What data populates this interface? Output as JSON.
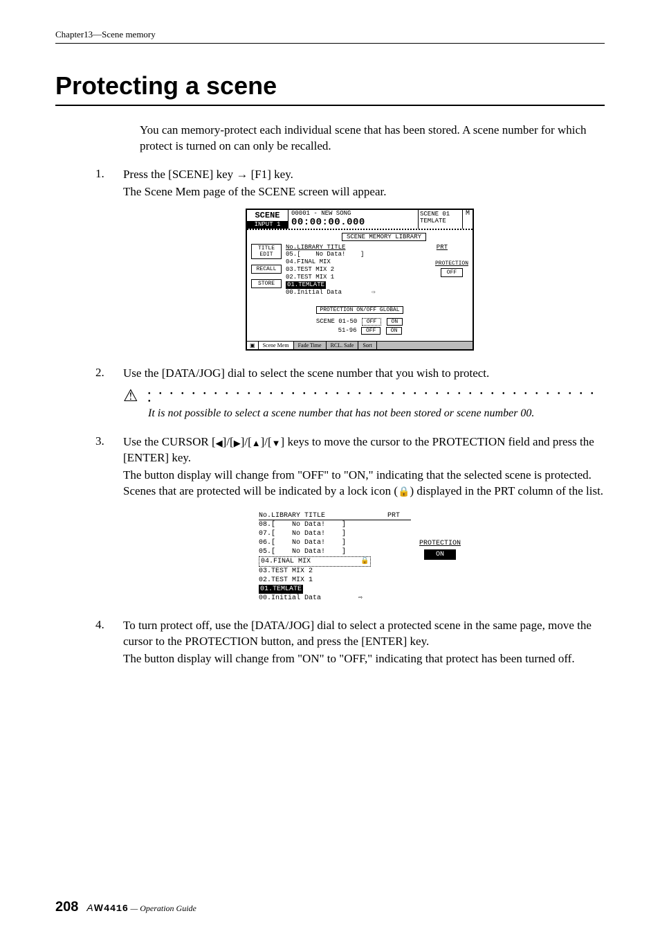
{
  "chapter": "Chapter13—Scene memory",
  "title": "Protecting a scene",
  "intro": "You can memory-protect each individual scene that has been stored. A scene number for which protect is turned on can only be recalled.",
  "step1": {
    "num": "1.",
    "head_a": "Press the [SCENE] key ",
    "head_b": " [F1] key.",
    "body": "The Scene Mem page of the SCENE screen will appear."
  },
  "scr1": {
    "scene": "SCENE",
    "input": "INPUT 1",
    "songid": "00001 - NEW SONG",
    "time": "00:00:00.000",
    "scene_no": "SCENE 01",
    "scene_name": "TEMLATE",
    "m_icon": "M",
    "lib_label": "SCENE MEMORY LIBRARY",
    "hdr_no": "No.LIBRARY TITLE",
    "hdr_prt": "PRT",
    "items": {
      "r0": "05.[    No Data!    ]",
      "r1": "04.FINAL MIX",
      "r2": "03.TEST MIX 2",
      "r3": "02.TEST MIX 1",
      "r4": "01.TEMLATE",
      "r5": "00.Initial Data        ⇨"
    },
    "btn_title": "TITLE\nEDIT",
    "btn_recall": "RECALL",
    "btn_store": "STORE",
    "protection": "PROTECTION",
    "off": "OFF",
    "global": "PROTECTION ON/OFF GLOBAL",
    "g1": "SCENE 01-50",
    "g2": "51-96",
    "g_off": "OFF",
    "g_on": "ON",
    "tab1": "Scene Mem",
    "tab2": "Fade Time",
    "tab3": "RCL. Safe",
    "tab4": "Sort"
  },
  "step2": {
    "num": "2.",
    "head": "Use the [DATA/JOG] dial to select the scene number that you wish to protect."
  },
  "caution": "It is not possible to select a scene number that has not been stored or scene number 00.",
  "step3": {
    "num": "3.",
    "head_a": "Use the CURSOR [",
    "head_b": "]/[",
    "head_e": "] keys to move the cursor to the PROTECTION field and press the [ENTER] key.",
    "body_a": "The button display will change from \"OFF\" to \"ON,\" indicating that the selected scene is protected. Scenes that are protected will be indicated by a lock icon (",
    "body_b": ") displayed in the PRT column of the list."
  },
  "scr2": {
    "hdr_no": "No.LIBRARY TITLE",
    "hdr_prt": "PRT",
    "r0": "08.[    No Data!    ]",
    "r1": "07.[    No Data!    ]",
    "r2": "06.[    No Data!    ]",
    "r3": "05.[    No Data!    ]",
    "r4": "04.FINAL MIX",
    "r4lock": "🔒",
    "r5": "03.TEST MIX 2",
    "r6": "02.TEST MIX 1",
    "r7": "01.TEMLATE",
    "r8": "00.Initial Data         ⇨",
    "protection": "PROTECTION",
    "on": "ON"
  },
  "step4": {
    "num": "4.",
    "head": "To turn protect off, use the [DATA/JOG] dial to select a protected scene in the same page, move the cursor to the PROTECTION button, and press the [ENTER] key.",
    "body": "The button display will change from \"ON\" to \"OFF,\" indicating that protect has been turned off."
  },
  "footer": {
    "page": "208",
    "model_a": "A",
    "model_w": "W",
    "model_num": "4416",
    "guide": " — Operation Guide"
  }
}
